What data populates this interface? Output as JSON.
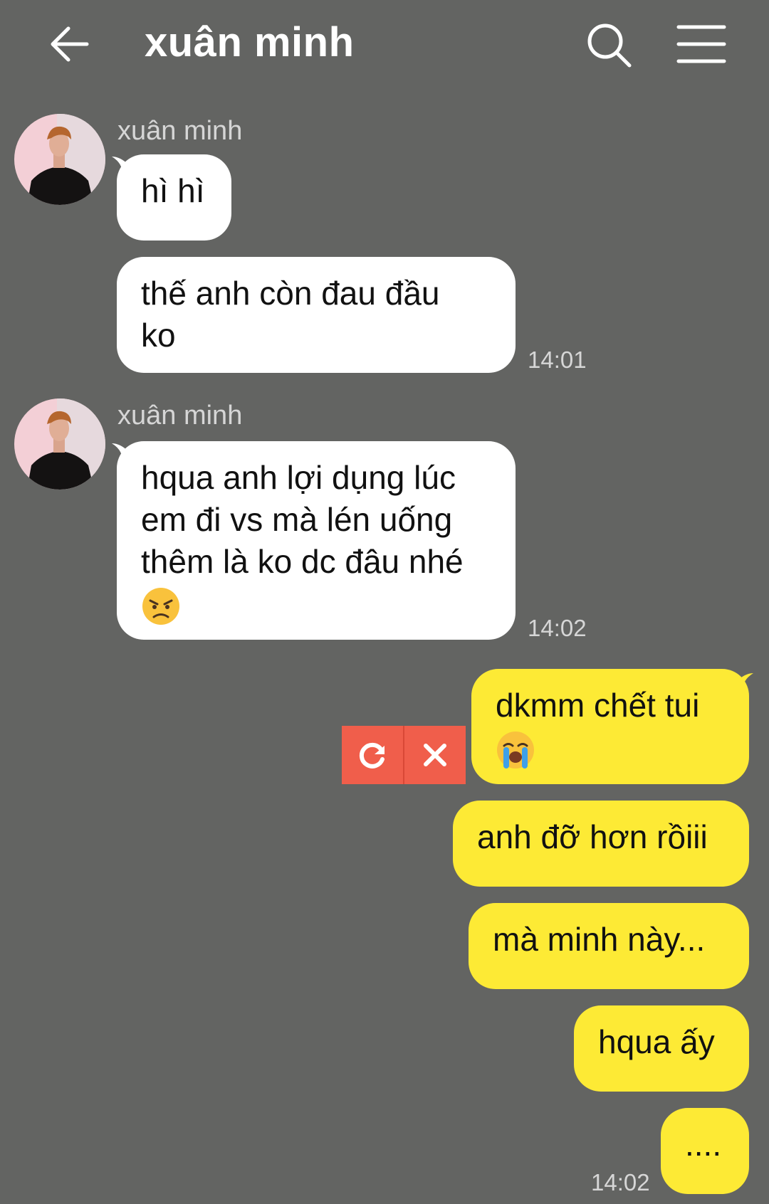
{
  "header": {
    "title": "xuân minh",
    "back_icon": "arrow-left-icon",
    "search_icon": "search-icon",
    "menu_icon": "hamburger-menu-icon"
  },
  "messages": {
    "group1": {
      "sender": "xuân minh",
      "msg1": "hì hì",
      "msg2_line1": "thế anh còn đau đầu",
      "msg2_line2": "ko",
      "time": "14:01"
    },
    "group2": {
      "sender": "xuân minh",
      "line1": "hqua anh lợi dụng lúc",
      "line2": "em đi vs mà lén uống",
      "line3": "thêm là ko dc đâu nhé",
      "emoji": "angry-face-emoji",
      "time": "14:02"
    },
    "outgoing": {
      "msg1_text": "dkmm chết tui",
      "msg1_emoji": "loudly-crying-face-emoji",
      "msg2": "anh đỡ hơn rồiii",
      "msg3": "mà minh này...",
      "msg4": "hqua ấy",
      "msg5": "....",
      "time": "14:02",
      "failed_actions": {
        "retry_icon": "retry-icon",
        "delete_icon": "close-icon"
      }
    }
  },
  "colors": {
    "background": "#636462",
    "incoming_bubble": "#ffffff",
    "outgoing_bubble": "#fdea35",
    "failed_action": "#f05e4b"
  }
}
